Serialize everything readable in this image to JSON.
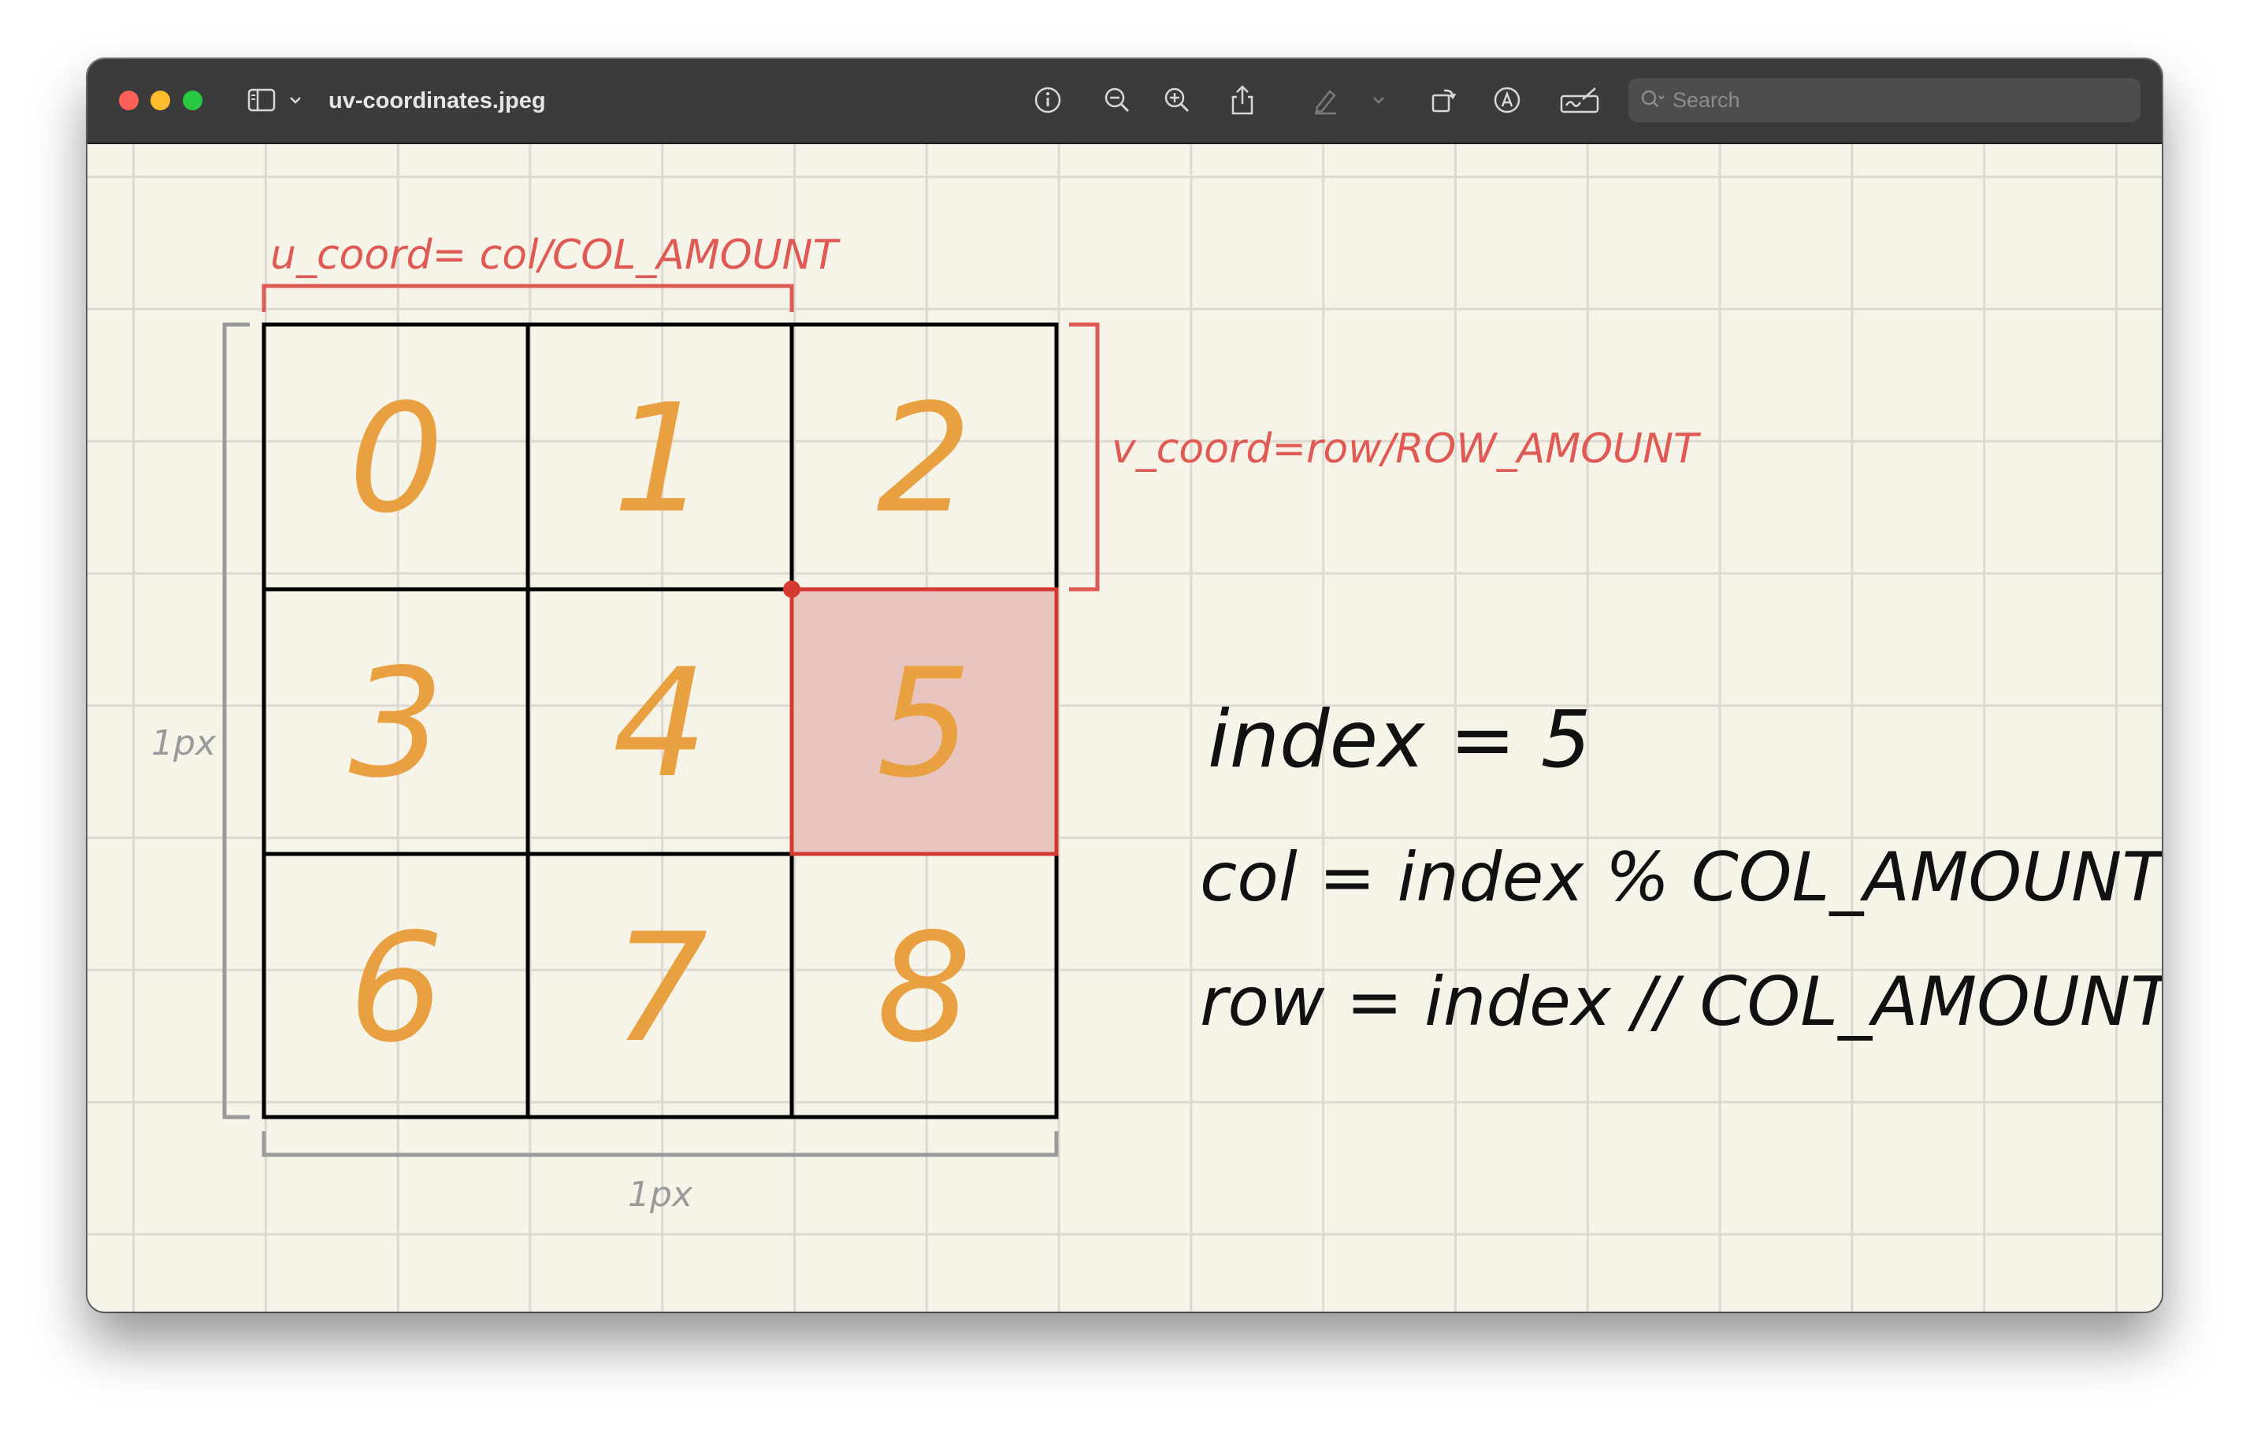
{
  "window": {
    "title": "uv-coordinates.jpeg"
  },
  "toolbar": {
    "icons": [
      "sidebar-icon",
      "chevron-down-icon",
      "info-icon",
      "zoom-out-icon",
      "zoom-in-icon",
      "share-icon",
      "highlight-pen-icon",
      "chevron-down-icon",
      "rotate-icon",
      "markup-icon",
      "signature-icon"
    ],
    "search_placeholder": "Search"
  },
  "diagram": {
    "cells": [
      "0",
      "1",
      "2",
      "3",
      "4",
      "5",
      "6",
      "7",
      "8"
    ],
    "highlighted_cell": "5",
    "u_label": "u_coord= col/COL_AMOUNT",
    "v_label": "v_coord=row/ROW_AMOUNT",
    "left_dimension": "1px",
    "bottom_dimension": "1px",
    "formula_index": "index = 5",
    "formula_col": "col = index % COL_AMOUNT",
    "formula_row": "row = index // COL_AMOUNT"
  },
  "colors": {
    "digit": "#e8a040",
    "annotation_red": "#e05a55",
    "highlight_fill": "#e7c4bd",
    "dimension_gray": "#9a9a9a",
    "grid_line": "#000000"
  }
}
